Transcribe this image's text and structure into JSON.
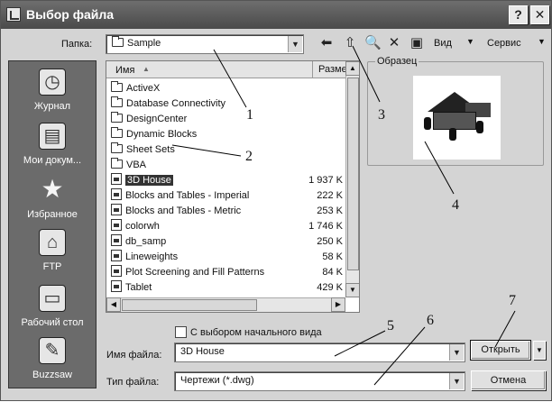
{
  "window": {
    "title": "Выбор файла",
    "help_label": "?",
    "close_label": "✕"
  },
  "lookin": {
    "label": "Папка:",
    "value": "Sample"
  },
  "toolbar": {
    "view_label": "Вид",
    "tools_label": "Сервис"
  },
  "places": [
    {
      "label": "Журнал",
      "icon": "history-icon"
    },
    {
      "label": "Мои докум...",
      "icon": "my-documents-icon"
    },
    {
      "label": "Избранное",
      "icon": "favorites-icon"
    },
    {
      "label": "FTP",
      "icon": "ftp-icon"
    },
    {
      "label": "Рабочий стол",
      "icon": "desktop-icon"
    },
    {
      "label": "Buzzsaw",
      "icon": "buzzsaw-icon"
    }
  ],
  "filelist": {
    "col_name": "Имя",
    "col_size": "Разме",
    "rows": [
      {
        "name": "ActiveX",
        "size": "",
        "type": "folder"
      },
      {
        "name": "Database Connectivity",
        "size": "",
        "type": "folder"
      },
      {
        "name": "DesignCenter",
        "size": "",
        "type": "folder"
      },
      {
        "name": "Dynamic Blocks",
        "size": "",
        "type": "folder"
      },
      {
        "name": "Sheet Sets",
        "size": "",
        "type": "folder"
      },
      {
        "name": "VBA",
        "size": "",
        "type": "folder"
      },
      {
        "name": "3D House",
        "size": "1 937 K",
        "type": "dwg"
      },
      {
        "name": "Blocks and Tables - Imperial",
        "size": "222 K",
        "type": "dwg"
      },
      {
        "name": "Blocks and Tables - Metric",
        "size": "253 K",
        "type": "dwg"
      },
      {
        "name": "colorwh",
        "size": "1 746 K",
        "type": "dwg"
      },
      {
        "name": "db_samp",
        "size": "250 K",
        "type": "dwg"
      },
      {
        "name": "Lineweights",
        "size": "58 K",
        "type": "dwg"
      },
      {
        "name": "Plot Screening and Fill Patterns",
        "size": "84 K",
        "type": "dwg"
      },
      {
        "name": "Tablet",
        "size": "429 K",
        "type": "dwg"
      }
    ]
  },
  "preview": {
    "label": "Образец"
  },
  "initial_view": {
    "label": "С выбором начального вида"
  },
  "filename": {
    "label": "Имя файла:",
    "value": "3D House"
  },
  "filetype": {
    "label": "Тип файла:",
    "value": "Чертежи (*.dwg)"
  },
  "buttons": {
    "open": "Открыть",
    "cancel": "Отмена"
  },
  "callouts": [
    "1",
    "2",
    "3",
    "4",
    "5",
    "6",
    "7"
  ]
}
